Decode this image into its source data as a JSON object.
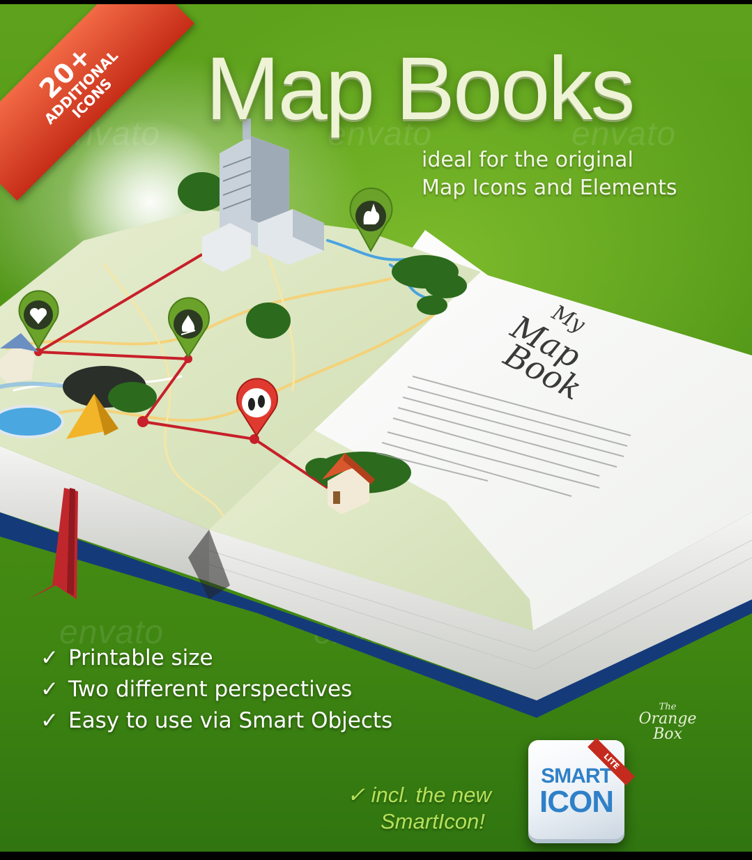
{
  "ribbon": {
    "count": "20+",
    "line1": "ADDITIONAL",
    "line2": "ICONS"
  },
  "header": {
    "title": "Map Books",
    "subtitle_line1": "ideal for the original",
    "subtitle_line2": "Map Icons and Elements"
  },
  "book": {
    "handwritten_line1": "My",
    "handwritten_line2": "Map",
    "handwritten_line3": "Book"
  },
  "features": {
    "check": "✓",
    "items": [
      "Printable size",
      "Two different perspectives",
      "Easy to use via Smart Objects"
    ]
  },
  "brand": {
    "the": "The",
    "name": "Orange Box"
  },
  "smart_note": {
    "check": "✓",
    "line1": "incl. the new",
    "line2": "SmartIcon!"
  },
  "smart_icon": {
    "line1": "SMART",
    "line2": "ICON",
    "badge": "LITE"
  },
  "watermark": "envato",
  "colors": {
    "background_green": "#4f9516",
    "ribbon_red": "#d8391f",
    "title_cream": "#eef3d6",
    "smart_note_green": "#b6e05a",
    "smart_icon_blue": "#2f80c7",
    "book_cover_blue": "#1d4fa0"
  },
  "icons": [
    "check-icon",
    "rabbit-pin-icon",
    "heart-pin-icon",
    "campfire-pin-icon",
    "footprints-pin-icon"
  ]
}
